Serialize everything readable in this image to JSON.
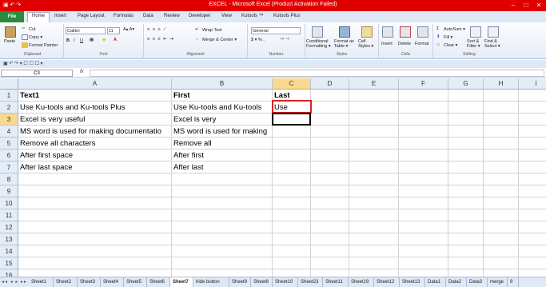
{
  "window": {
    "title": "EXCEL - Microsoft Excel (Product Activation Failed)",
    "controls": [
      "–",
      "□",
      "✕"
    ],
    "titlebar_color": "#e00000"
  },
  "tabs": [
    "File",
    "Home",
    "Insert",
    "Page Layout",
    "Formulas",
    "Data",
    "Review",
    "Developer",
    "View",
    "Kutools ™",
    "Kutools Plus"
  ],
  "ribbon": {
    "clipboard": {
      "paste": "Paste",
      "cut": "Cut",
      "copy": "Copy ▾",
      "format_painter": "Format Painter",
      "label": "Clipboard"
    },
    "font": {
      "name": "Calibri",
      "size": "11",
      "label": "Font",
      "bold": "B",
      "italic": "I",
      "underline": "U"
    },
    "alignment": {
      "wrap": "Wrap Text",
      "merge": "Merge & Center ▾",
      "label": "Alignment"
    },
    "number": {
      "format": "General",
      "currency": "$ ▾ % ,",
      "label": "Number"
    },
    "styles": {
      "conditional": "Conditional Formatting ▾",
      "format_table": "Format as Table ▾",
      "cell_styles": "Cell Styles ▾",
      "label": "Styles"
    },
    "cells": {
      "insert": "Insert",
      "delete": "Delete",
      "format": "Format",
      "label": "Cells"
    },
    "editing": {
      "autosum": "AutoSum ▾",
      "fill": "Fill ▾",
      "clear": "Clear ▾",
      "sort": "Sort & Filter ▾",
      "find": "Find & Select ▾",
      "label": "Editing"
    }
  },
  "formula_bar": {
    "name_box": "C3",
    "fx": "fx",
    "value": ""
  },
  "columns": [
    {
      "name": "A"
    },
    {
      "name": "B"
    },
    {
      "name": "C"
    },
    {
      "name": "D"
    },
    {
      "name": "E"
    },
    {
      "name": "F"
    },
    {
      "name": "G"
    },
    {
      "name": "H"
    },
    {
      "name": "I"
    }
  ],
  "selected_column": "C",
  "selected_row": "3",
  "rows": [
    {
      "n": "1",
      "A": "Text1",
      "B": "First",
      "C": "Last",
      "bold": true
    },
    {
      "n": "2",
      "A": "Use Ku-tools and Ku-tools Plus",
      "B": "Use Ku-tools and Ku-tools",
      "C": "Use"
    },
    {
      "n": "3",
      "A": "Excel is very useful",
      "B": "Excel is very",
      "C": ""
    },
    {
      "n": "4",
      "A": "MS word is used for making documentatio",
      "B": "MS word is used for making",
      "C": ""
    },
    {
      "n": "5",
      "A": "Remove all characters",
      "B": "Remove all",
      "C": ""
    },
    {
      "n": "6",
      "A": "After first space",
      "B": "After first",
      "C": ""
    },
    {
      "n": "7",
      "A": "After last space",
      "B": "After last",
      "C": ""
    },
    {
      "n": "8"
    },
    {
      "n": "9"
    },
    {
      "n": "10"
    },
    {
      "n": "11"
    },
    {
      "n": "12"
    },
    {
      "n": "13"
    },
    {
      "n": "14"
    },
    {
      "n": "15"
    },
    {
      "n": "16"
    }
  ],
  "sheet_nav": "◂◂ ◂ ▸ ▸▸",
  "sheets": [
    "Sheet1",
    "Sheet2",
    "Sheet3",
    "Sheet4",
    "Sheet5",
    "Sheet6",
    "Sheet7",
    "hide button",
    "Sheet9",
    "Sheet8",
    "Sheet10",
    "Sheet23",
    "Sheet11",
    "Sheet19",
    "Sheet12",
    "Sheet13",
    "Data1",
    "Data2",
    "Data3",
    "merge",
    "9"
  ],
  "active_sheet": "Sheet7"
}
